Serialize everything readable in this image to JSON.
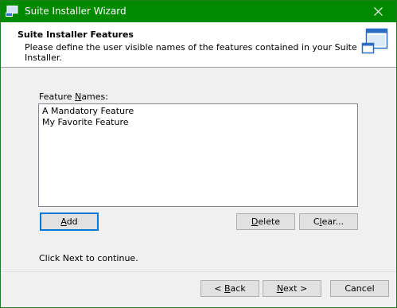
{
  "window": {
    "title": "Suite Installer Wizard",
    "accent_color": "#008a00"
  },
  "header": {
    "title": "Suite Installer Features",
    "description": "Please define the user visible names of the features contained in your Suite Installer.",
    "icon": "installer-window-icon"
  },
  "features": {
    "label_pre": "Feature ",
    "label_mnemonic": "N",
    "label_post": "ames:",
    "items": [
      "A Mandatory Feature",
      "My Favorite Feature"
    ]
  },
  "buttons": {
    "add_mnemonic": "A",
    "add_rest": "dd",
    "delete_mnemonic": "D",
    "delete_rest": "elete",
    "clear_pre": "C",
    "clear_mnemonic": "l",
    "clear_rest": "ear...",
    "back_pre": "< ",
    "back_mnemonic": "B",
    "back_rest": "ack",
    "next_mnemonic": "N",
    "next_rest": "ext >",
    "cancel": "Cancel"
  },
  "footer": {
    "hint": "Click Next to continue."
  }
}
